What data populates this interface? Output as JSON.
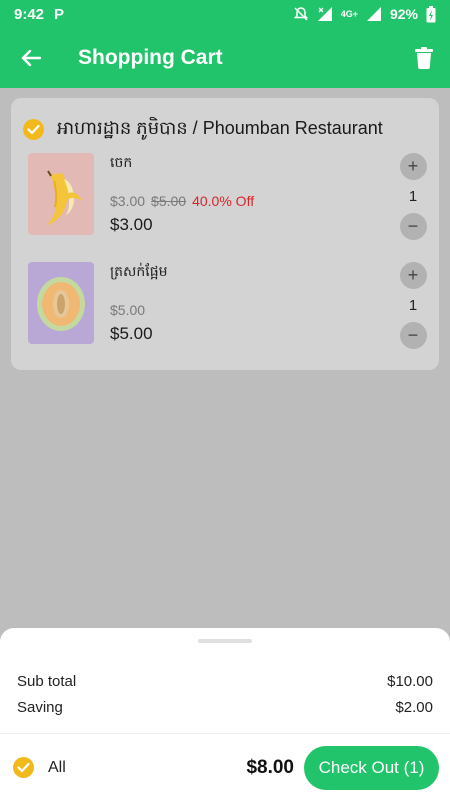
{
  "status_bar": {
    "time": "9:42",
    "app_icon": "P",
    "network": "4G+",
    "battery": "92%"
  },
  "header": {
    "title": "Shopping Cart",
    "back_icon": "arrow-left",
    "delete_icon": "trash"
  },
  "cart": {
    "store_name": "អាហារដ្ឋាន ភូមិបាន / Phoumban Restaurant",
    "store_checked": true,
    "items": [
      {
        "name": "ចេក",
        "price": "$3.00",
        "original_price": "$5.00",
        "discount": "40.0% Off",
        "final_price": "$3.00",
        "quantity": "1"
      },
      {
        "name": "ត្រសក់ផ្អែម",
        "price": "$5.00",
        "final_price": "$5.00",
        "quantity": "1"
      }
    ]
  },
  "summary": {
    "subtotal_label": "Sub total",
    "subtotal_value": "$10.00",
    "saving_label": "Saving",
    "saving_value": "$2.00",
    "all_label": "All",
    "total": "$8.00",
    "checkout_label": "Check Out (1)"
  },
  "colors": {
    "primary": "#21c46a",
    "check": "#f2b91d",
    "discount": "#d8252a"
  }
}
